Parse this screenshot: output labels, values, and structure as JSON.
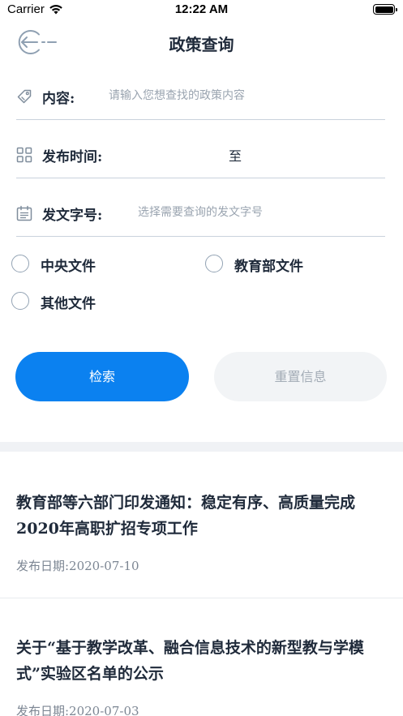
{
  "status_bar": {
    "carrier": "Carrier",
    "time": "12:22 AM"
  },
  "nav": {
    "title": "政策查询",
    "back_icon": "back-arrow-circle-icon"
  },
  "form": {
    "content": {
      "label": "内容:",
      "placeholder": "请输入您想查找的政策内容",
      "value": "",
      "icon": "tag-icon"
    },
    "publish_time": {
      "label": "发布时间:",
      "start": "",
      "separator": "至",
      "end": "",
      "icon": "grid-icon"
    },
    "doc_number": {
      "label": "发文字号:",
      "placeholder": "选择需要查询的发文字号",
      "value": "",
      "icon": "calendar-icon"
    }
  },
  "filters": [
    {
      "label": "中央文件",
      "checked": false
    },
    {
      "label": "教育部文件",
      "checked": false
    },
    {
      "label": "其他文件",
      "checked": false
    }
  ],
  "buttons": {
    "search": "检索",
    "reset": "重置信息"
  },
  "results": [
    {
      "title": "教育部等六部门印发通知：稳定有序、高质量完成2020年高职扩招专项工作",
      "date": "发布日期:2020-07-10"
    },
    {
      "title": "关于“基于教学改革、融合信息技术的新型教与学模式”实验区名单的公示",
      "date": "发布日期:2020-07-03"
    }
  ],
  "colors": {
    "primary": "#0b81f0",
    "text": "#1f2a3a",
    "muted": "#9aa4b0",
    "divider": "#c9d2dc"
  }
}
